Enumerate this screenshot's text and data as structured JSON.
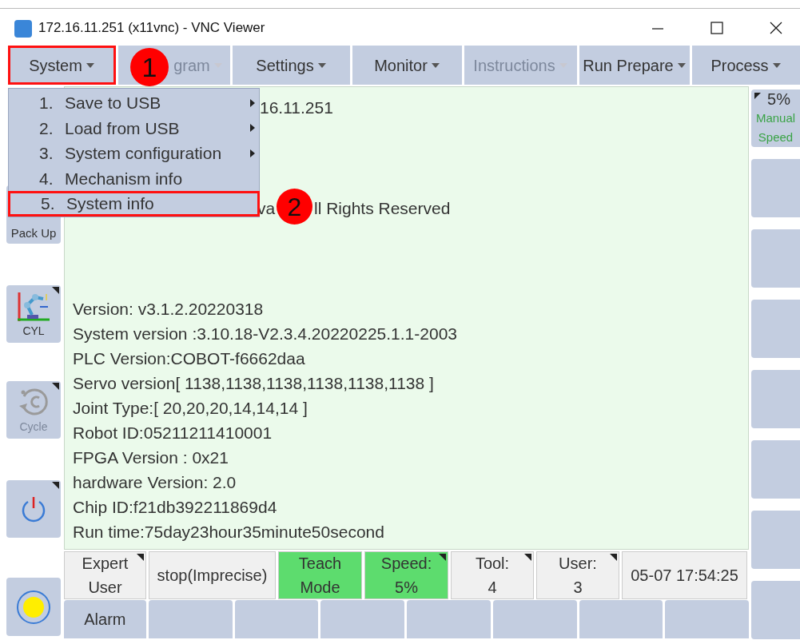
{
  "window": {
    "title": "172.16.11.251 (x11vnc) - VNC Viewer"
  },
  "menu_bar": [
    {
      "label": "System",
      "disabled": false,
      "annotated": true
    },
    {
      "label": "gram",
      "disabled": true,
      "annotated": false
    },
    {
      "label": "Settings",
      "disabled": false,
      "annotated": false
    },
    {
      "label": "Monitor",
      "disabled": false,
      "annotated": false
    },
    {
      "label": "Instructions",
      "disabled": true,
      "annotated": false
    },
    {
      "label": "Run Prepare",
      "disabled": false,
      "annotated": false
    },
    {
      "label": "Process",
      "disabled": false,
      "annotated": false
    }
  ],
  "dropdown": [
    {
      "number": "1.",
      "label": "Save to USB",
      "submenu": true,
      "annotated": false
    },
    {
      "number": "2.",
      "label": "Load from USB",
      "submenu": true,
      "annotated": false
    },
    {
      "number": "3.",
      "label": "System configuration",
      "submenu": true,
      "annotated": false
    },
    {
      "number": "4.",
      "label": "Mechanism info",
      "submenu": false,
      "annotated": false
    },
    {
      "number": "5.",
      "label": "System info",
      "submenu": false,
      "annotated": true
    }
  ],
  "annotations": [
    {
      "label": "1"
    },
    {
      "label": "2"
    }
  ],
  "content": {
    "partial": [
      "16.11.251",
      "va",
      "ll Rights Reserved"
    ],
    "info": [
      "Version: v3.1.2.20220318",
      "System version :3.10.18-V2.3.4.20220225.1.1-2003",
      "PLC Version:COBOT-f6662daa",
      "Servo version[ 1138,1138,1138,1138,1138,1138 ]",
      "Joint Type:[ 20,20,20,14,14,14 ]",
      "Robot ID:05211211410001",
      "FPGA Version : 0x21",
      "hardware Version: 2.0",
      "Chip ID:f21db392211869d4",
      "Run time:75day23hour35minute50second"
    ]
  },
  "left_buttons": [
    {
      "kind": "text",
      "label": "Pack Up",
      "disabled": false
    },
    {
      "kind": "coords",
      "label": "CYL",
      "disabled": false
    },
    {
      "kind": "cycle",
      "label": "Cycle",
      "disabled": true
    },
    {
      "kind": "power"
    },
    {
      "kind": "lamp"
    }
  ],
  "speed": {
    "value": "5%",
    "lines": [
      "Manual",
      "Speed"
    ]
  },
  "status": [
    {
      "lines": [
        "Expert",
        "User"
      ],
      "active": false,
      "menu": true
    },
    {
      "lines": [
        "stop(Imprecise)"
      ],
      "active": false,
      "menu": false
    },
    {
      "lines": [
        "Teach",
        "Mode"
      ],
      "active": true,
      "menu": false
    },
    {
      "lines": [
        "Speed:",
        "5%"
      ],
      "active": true,
      "menu": true
    },
    {
      "lines": [
        "Tool:",
        "4"
      ],
      "active": false,
      "menu": true
    },
    {
      "lines": [
        "User:",
        "3"
      ],
      "active": false,
      "menu": true
    },
    {
      "lines": [
        "05-07 17:54:25"
      ],
      "active": false,
      "menu": false
    }
  ],
  "bottom_buttons": [
    "Alarm"
  ]
}
